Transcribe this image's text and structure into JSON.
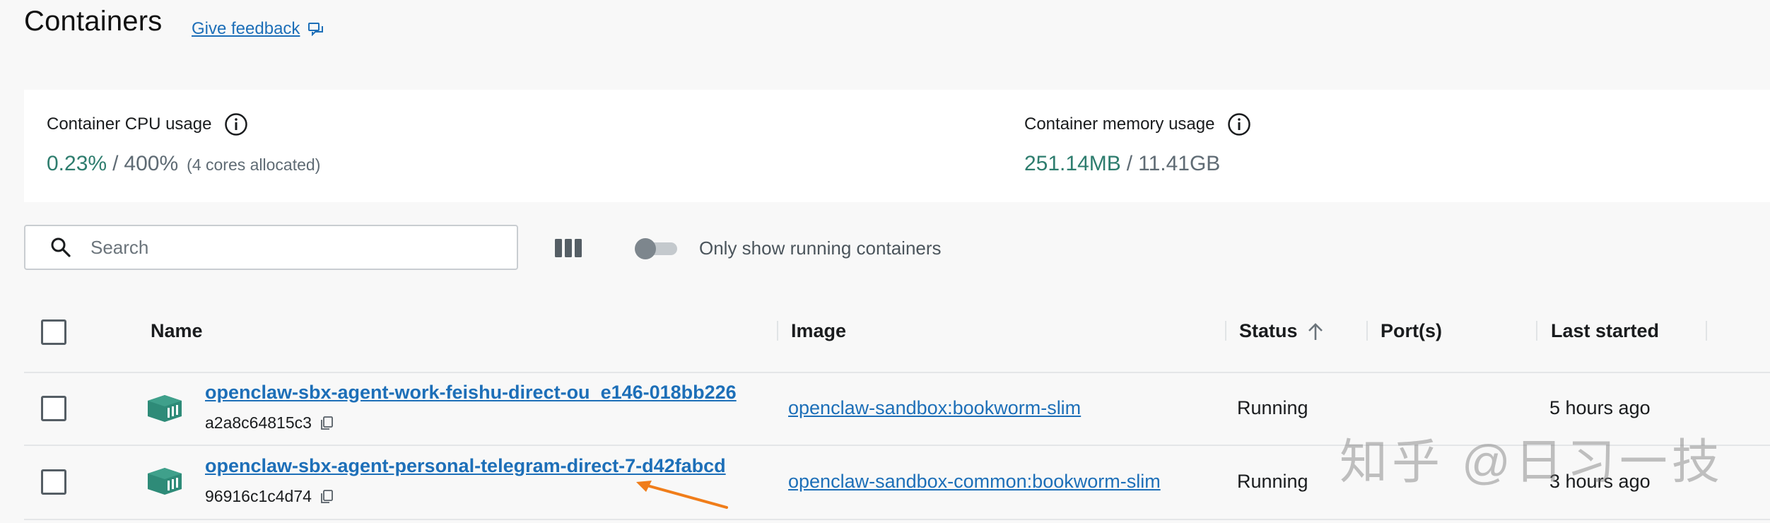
{
  "header": {
    "title": "Containers",
    "feedback_label": "Give feedback"
  },
  "stats": {
    "cpu": {
      "label": "Container CPU usage",
      "value": "0.23%",
      "separator": "/",
      "total": "400%",
      "note": "(4 cores allocated)"
    },
    "memory": {
      "label": "Container memory usage",
      "value": "251.14MB",
      "separator": "/",
      "total": "11.41GB"
    }
  },
  "toolbar": {
    "search_placeholder": "Search",
    "search_value": "",
    "toggle_label": "Only show running containers",
    "toggle_on": false
  },
  "table": {
    "columns": {
      "name": "Name",
      "image": "Image",
      "status": "Status",
      "ports": "Port(s)",
      "last_started": "Last started"
    },
    "sort": {
      "column": "Status",
      "direction": "ascending"
    },
    "rows": [
      {
        "name": "openclaw-sbx-agent-work-feishu-direct-ou_e146-018bb226",
        "id": "a2a8c64815c3",
        "image": "openclaw-sandbox:bookworm-slim",
        "status": "Running",
        "ports": "",
        "last_started": "5 hours ago"
      },
      {
        "name": "openclaw-sbx-agent-personal-telegram-direct-7-d42fabcd",
        "id": "96916c1c4d74",
        "image": "openclaw-sandbox-common:bookworm-slim",
        "status": "Running",
        "ports": "",
        "last_started": "3 hours ago"
      }
    ]
  },
  "watermark": "知乎 @日习一技",
  "colors": {
    "accent_link": "#1d6fb8",
    "stat_value": "#2e7d6e",
    "container_icon": "#2e8b78",
    "annotation_arrow": "#f07d1a"
  }
}
